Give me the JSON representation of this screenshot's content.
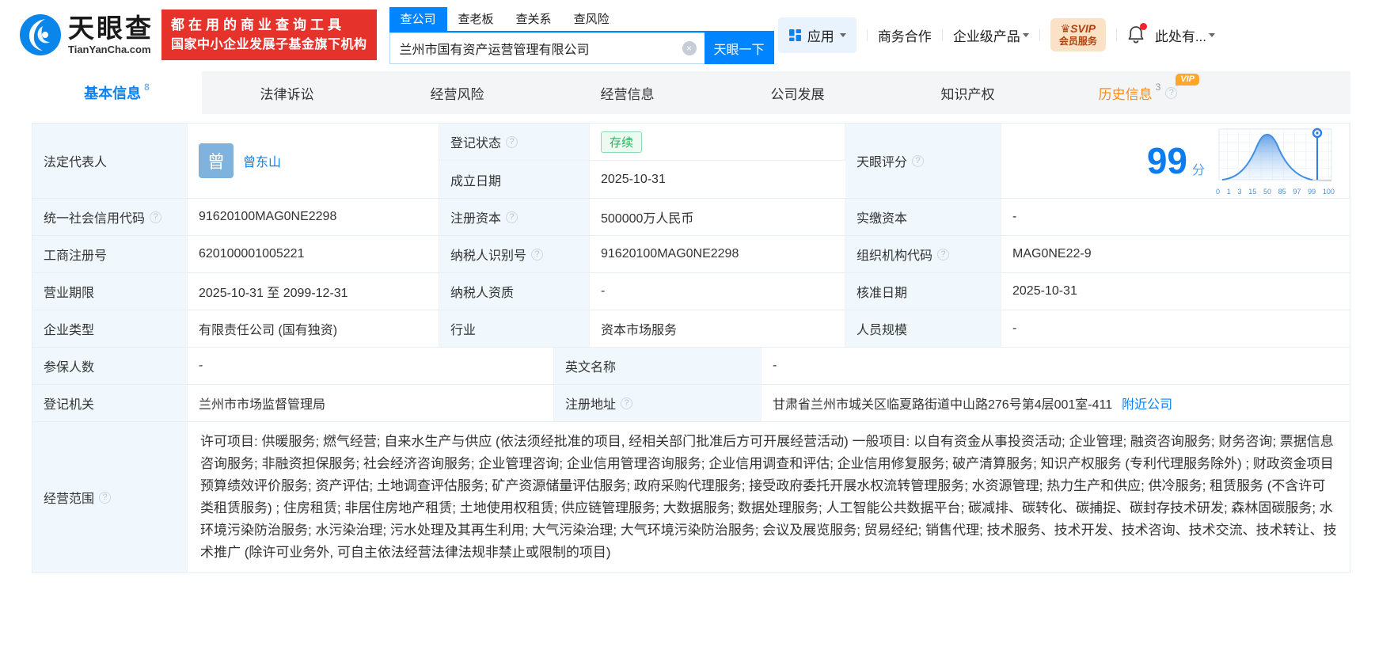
{
  "header": {
    "logo": {
      "name": "天眼查",
      "domain": "TianYanCha.com"
    },
    "promo": {
      "line1": "都在用的商业查询工具",
      "line2": "国家中小企业发展子基金旗下机构"
    },
    "search": {
      "tabs": [
        {
          "label": "查公司",
          "active": true
        },
        {
          "label": "查老板"
        },
        {
          "label": "查关系"
        },
        {
          "label": "查风险"
        }
      ],
      "value": "兰州市国有资产运营管理有限公司",
      "clear_icon": "×",
      "button": "天眼一下"
    },
    "nav": {
      "apps": "应用",
      "cooperation": "商务合作",
      "enterprise": "企业级产品",
      "svip_line1": "SVIP",
      "svip_line2": "会员服务",
      "svip_crown": "♛",
      "more": "此处有..."
    }
  },
  "tabs": [
    {
      "label": "基本信息",
      "count": "8",
      "active": true
    },
    {
      "label": "法律诉讼"
    },
    {
      "label": "经营风险"
    },
    {
      "label": "经营信息"
    },
    {
      "label": "公司发展"
    },
    {
      "label": "知识产权"
    },
    {
      "label": "历史信息",
      "count": "3",
      "vip": "VIP"
    }
  ],
  "fields": {
    "legal_rep": {
      "label": "法定代表人",
      "avatar": "曾",
      "value": "曾东山"
    },
    "reg_status": {
      "label": "登记状态",
      "value": "存续"
    },
    "est_date": {
      "label": "成立日期",
      "value": "2025-10-31"
    },
    "credit_code": {
      "label": "统一社会信用代码",
      "value": "91620100MAG0NE2298"
    },
    "reg_capital": {
      "label": "注册资本",
      "value": "500000万人民币"
    },
    "paid_capital": {
      "label": "实缴资本",
      "value": "-"
    },
    "reg_number": {
      "label": "工商注册号",
      "value": "620100001005221"
    },
    "taxpayer_id": {
      "label": "纳税人识别号",
      "value": "91620100MAG0NE2298"
    },
    "org_code": {
      "label": "组织机构代码",
      "value": "MAG0NE22-9"
    },
    "business_term": {
      "label": "营业期限",
      "value": "2025-10-31 至 2099-12-31"
    },
    "taxpayer_quality": {
      "label": "纳税人资质",
      "value": "-"
    },
    "approval_date": {
      "label": "核准日期",
      "value": "2025-10-31"
    },
    "company_type": {
      "label": "企业类型",
      "value": "有限责任公司 (国有独资)"
    },
    "industry": {
      "label": "行业",
      "value": "资本市场服务"
    },
    "staff_size": {
      "label": "人员规模",
      "value": "-"
    },
    "insured_count": {
      "label": "参保人数",
      "value": "-"
    },
    "english_name": {
      "label": "英文名称",
      "value": "-"
    },
    "reg_authority": {
      "label": "登记机关",
      "value": "兰州市市场监督管理局"
    },
    "reg_address": {
      "label": "注册地址",
      "value": "甘肃省兰州市城关区临夏路街道中山路276号第4层001室-411",
      "link": "附近公司"
    },
    "business_scope": {
      "label": "经营范围",
      "value": "许可项目: 供暖服务; 燃气经营; 自来水生产与供应 (依法须经批准的项目, 经相关部门批准后方可开展经营活动) 一般项目: 以自有资金从事投资活动; 企业管理; 融资咨询服务; 财务咨询; 票据信息咨询服务; 非融资担保服务; 社会经济咨询服务; 企业管理咨询; 企业信用管理咨询服务; 企业信用调查和评估; 企业信用修复服务; 破产清算服务; 知识产权服务 (专利代理服务除外) ; 财政资金项目预算绩效评价服务; 资产评估; 土地调查评估服务; 矿产资源储量评估服务; 政府采购代理服务; 接受政府委托开展水权流转管理服务; 水资源管理; 热力生产和供应; 供冷服务; 租赁服务 (不含许可类租赁服务) ; 住房租赁; 非居住房地产租赁; 土地使用权租赁; 供应链管理服务; 大数据服务; 数据处理服务; 人工智能公共数据平台; 碳减排、碳转化、碳捕捉、碳封存技术研发; 森林固碳服务; 水环境污染防治服务; 水污染治理; 污水处理及其再生利用; 大气污染治理; 大气环境污染防治服务; 会议及展览服务; 贸易经纪; 销售代理; 技术服务、技术开发、技术咨询、技术交流、技术转让、技术推广 (除许可业务外, 可自主依法经营法律法规非禁止或限制的项目)"
    }
  },
  "score": {
    "label": "天眼评分",
    "value": "99",
    "unit": "分",
    "axis": [
      "0",
      "1",
      "3",
      "15",
      "50",
      "85",
      "97",
      "99",
      "100"
    ]
  },
  "colors": {
    "accent_blue": "#0084ff",
    "promo_red": "#e5332c",
    "vip_orange": "#ffa62b",
    "status_green": "#2cb35a",
    "notification_red": "#f5222d",
    "label_cell_bg": "#f0f8fd"
  },
  "chart_data": {
    "type": "area",
    "title": "天眼评分分布曲线",
    "x_tick_labels": [
      "0",
      "1",
      "3",
      "15",
      "50",
      "85",
      "97",
      "99",
      "100"
    ],
    "relative_heights": [
      0.02,
      0.05,
      0.18,
      0.85,
      1.0,
      0.4,
      0.08,
      0.02,
      0.01
    ],
    "marker_value": 99,
    "score": 99,
    "grid": true,
    "legend": false
  }
}
